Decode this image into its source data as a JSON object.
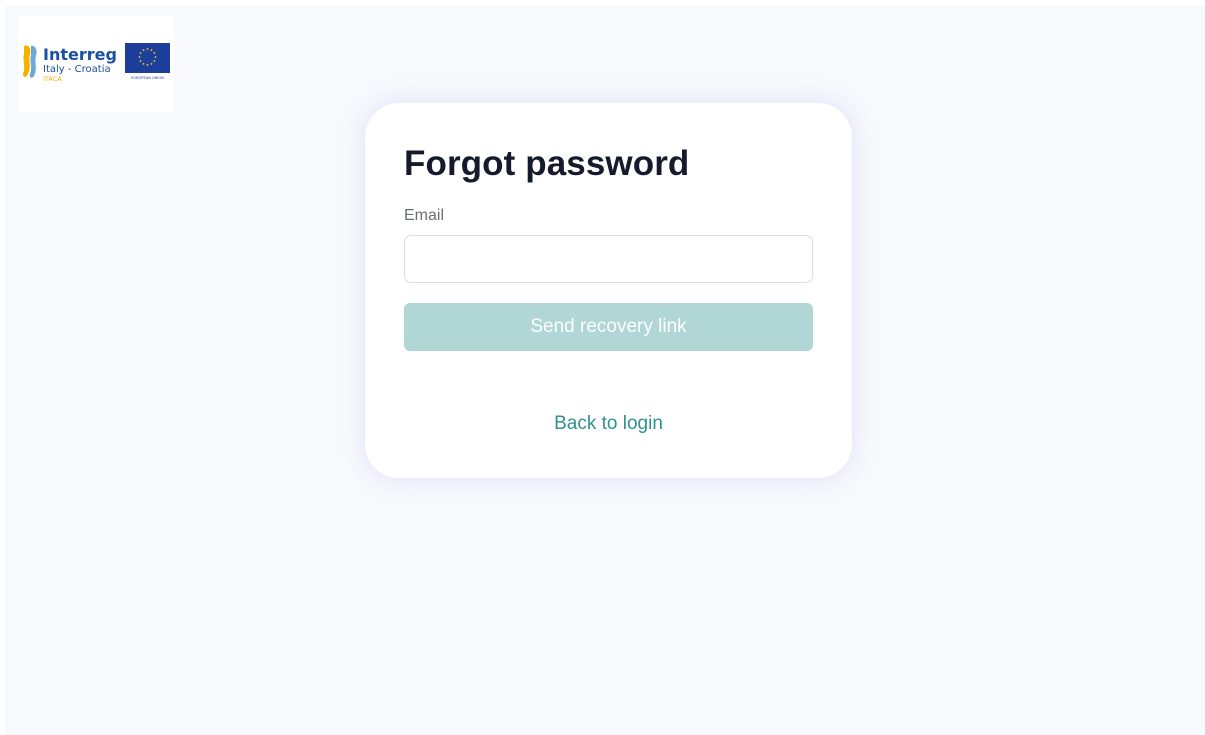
{
  "logo": {
    "brand": "Interreg",
    "program": "Italy - Croatia",
    "project": "ITACA",
    "eu_label": "EUROPEAN UNION",
    "colors": {
      "brand_blue": "#1c4ea2",
      "project_yellow": "#f3b200",
      "eu_blue": "#1d3f9c",
      "eu_star": "#ffd200"
    }
  },
  "form": {
    "title": "Forgot password",
    "email_label": "Email",
    "email_value": "",
    "email_placeholder": "",
    "submit_label": "Send recovery link",
    "back_label": "Back to login"
  },
  "colors": {
    "background": "#f8f9fd",
    "button_disabled": "#b0d6d6",
    "link": "#2e9291",
    "title": "#151b2c"
  }
}
